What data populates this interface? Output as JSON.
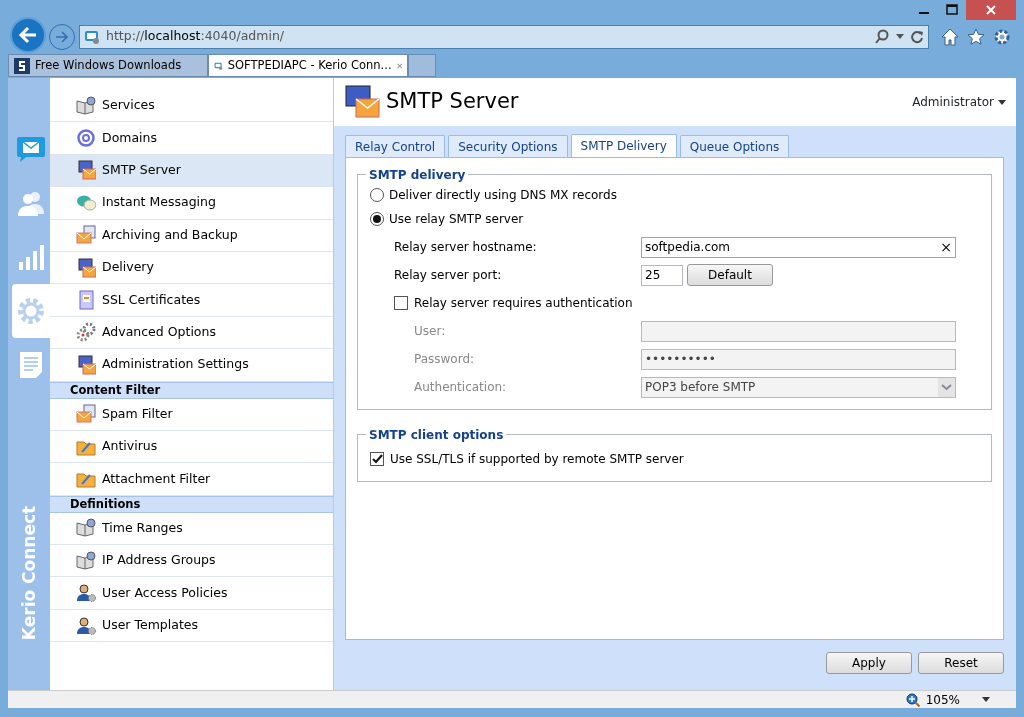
{
  "browser": {
    "address": "http://localhost:4040/admin/",
    "tabs": [
      {
        "title": "Free Windows Downloads",
        "kind": "site",
        "selected": false
      },
      {
        "title": "SOFTPEDIAPC - Kerio Conn...",
        "kind": "app",
        "selected": true
      }
    ],
    "zoom": "105%"
  },
  "rail": {
    "brand": "Kerio Connect",
    "items": [
      {
        "kind": "mail",
        "selected": false
      },
      {
        "kind": "users",
        "selected": false
      },
      {
        "kind": "chart",
        "selected": false
      },
      {
        "kind": "gear",
        "selected": true
      },
      {
        "kind": "document",
        "selected": false
      }
    ]
  },
  "sidebar": {
    "sections": [
      {
        "items": [
          {
            "label": "Services",
            "kind": "book",
            "selected": false
          },
          {
            "label": "Domains",
            "kind": "at",
            "selected": false
          },
          {
            "label": "SMTP Server",
            "kind": "monitor",
            "selected": true
          },
          {
            "label": "Instant Messaging",
            "kind": "chat",
            "selected": false
          },
          {
            "label": "Archiving and Backup",
            "kind": "envelope",
            "selected": false
          },
          {
            "label": "Delivery",
            "kind": "monitor",
            "selected": false
          },
          {
            "label": "SSL Certificates",
            "kind": "certificate",
            "selected": false
          },
          {
            "label": "Advanced Options",
            "kind": "gear",
            "selected": false
          },
          {
            "label": "Administration Settings",
            "kind": "monitor",
            "selected": false
          }
        ]
      },
      {
        "heading": "Content Filter",
        "items": [
          {
            "label": "Spam Filter",
            "kind": "envelope",
            "selected": false
          },
          {
            "label": "Antivirus",
            "kind": "folder",
            "selected": false
          },
          {
            "label": "Attachment Filter",
            "kind": "folder",
            "selected": false
          }
        ]
      },
      {
        "heading": "Definitions",
        "items": [
          {
            "label": "Time Ranges",
            "kind": "book",
            "selected": false
          },
          {
            "label": "IP Address Groups",
            "kind": "book",
            "selected": false
          },
          {
            "label": "User Access Policies",
            "kind": "user",
            "selected": false
          },
          {
            "label": "User Templates",
            "kind": "user",
            "selected": false
          }
        ]
      }
    ]
  },
  "header": {
    "title": "SMTP Server",
    "user": "Administrator"
  },
  "tabs": [
    {
      "label": "Relay Control",
      "selected": false
    },
    {
      "label": "Security Options",
      "selected": false
    },
    {
      "label": "SMTP Delivery",
      "selected": true
    },
    {
      "label": "Queue Options",
      "selected": false
    }
  ],
  "smtp_delivery": {
    "legend": "SMTP delivery",
    "options": [
      {
        "label": "Deliver directly using DNS MX records",
        "selected": false
      },
      {
        "label": "Use relay SMTP server",
        "selected": true
      }
    ],
    "hostname": {
      "label": "Relay server hostname:",
      "value": "softpedia.com",
      "clear": "×"
    },
    "port": {
      "label": "Relay server port:",
      "value": "25",
      "button": "Default"
    },
    "auth": {
      "label": "Relay server requires authentication",
      "checked": false,
      "fields": [
        {
          "kind": "text",
          "label": "User:",
          "disabled": true
        },
        {
          "kind": "password",
          "label": "Password:",
          "value": "••••••••••",
          "disabled": true
        },
        {
          "kind": "select",
          "label": "Authentication:",
          "value": "POP3 before SMTP",
          "disabled": true
        }
      ]
    }
  },
  "client_options": {
    "legend": "SMTP client options",
    "options": [
      {
        "label": "Use SSL/TLS if supported by remote SMTP server",
        "checked": true
      }
    ]
  },
  "buttons": [
    "Apply",
    "Reset"
  ]
}
